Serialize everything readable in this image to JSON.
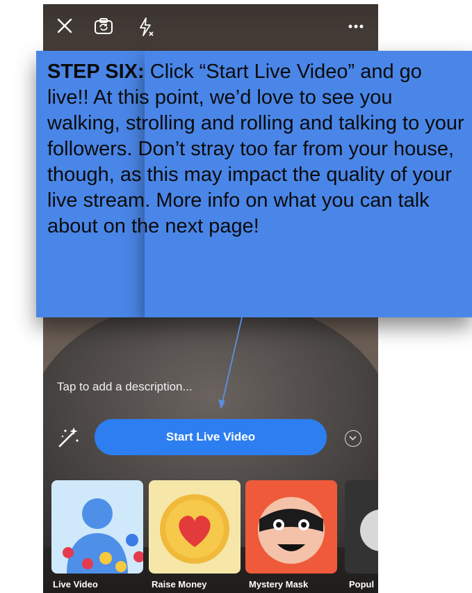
{
  "callout": {
    "step_label": "STEP SIX:",
    "body": "Click “Start Live Video” and go live!! At this point, we’d love to see you walking, strolling and rolling and talking to your followers. Don’t stray too far from your house, though, as this may impact the quality of your live stream. More info on what you can talk about on the next page!"
  },
  "topbar": {
    "close_icon": "close-icon",
    "flip_camera_icon": "camera-flip-icon",
    "flash_off_icon": "flash-off-icon",
    "more_icon": "more-icon"
  },
  "description_placeholder": "Tap to add a description...",
  "start_button_label": "Start Live Video",
  "tiles": [
    {
      "label": "Live Video"
    },
    {
      "label": "Raise Money"
    },
    {
      "label": "Mystery Mask"
    },
    {
      "label": "Popul"
    }
  ],
  "colors": {
    "accent": "#2d7ef0",
    "callout_bg": "#4a86e8"
  }
}
